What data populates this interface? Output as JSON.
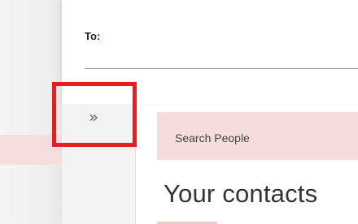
{
  "compose": {
    "to_label": "To:"
  },
  "people_pane": {
    "expand_icon": "double-chevron-right-icon",
    "expand_glyph": "»",
    "search": {
      "placeholder": "Search People"
    },
    "contacts_heading": "Your contacts"
  },
  "colors": {
    "highlight_box": "#e31e24",
    "search_background": "#f6dcda",
    "left_highlight": "#f7dede"
  }
}
